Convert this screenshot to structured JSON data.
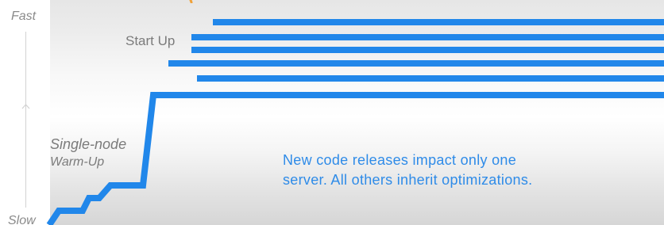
{
  "axis": {
    "top_label": "Fast",
    "bottom_label": "Slow"
  },
  "labels": {
    "start_up": "Start Up",
    "warmup_title": "Single-node",
    "warmup_subtitle": "Warm-Up"
  },
  "annotation": {
    "line1": "New code releases impact only one",
    "line2": "server. All others inherit optimizations."
  },
  "colors": {
    "accent_blue": "#2187ea",
    "annotation_blue": "#2e8be8",
    "label_gray": "#7b7b7b",
    "axis_gray": "#d2d2d2",
    "orange_glyph": "#f0a23a"
  },
  "icons": {
    "axis_direction": "up-arrow-icon",
    "decorative_top": "orange-glow-icon"
  }
}
